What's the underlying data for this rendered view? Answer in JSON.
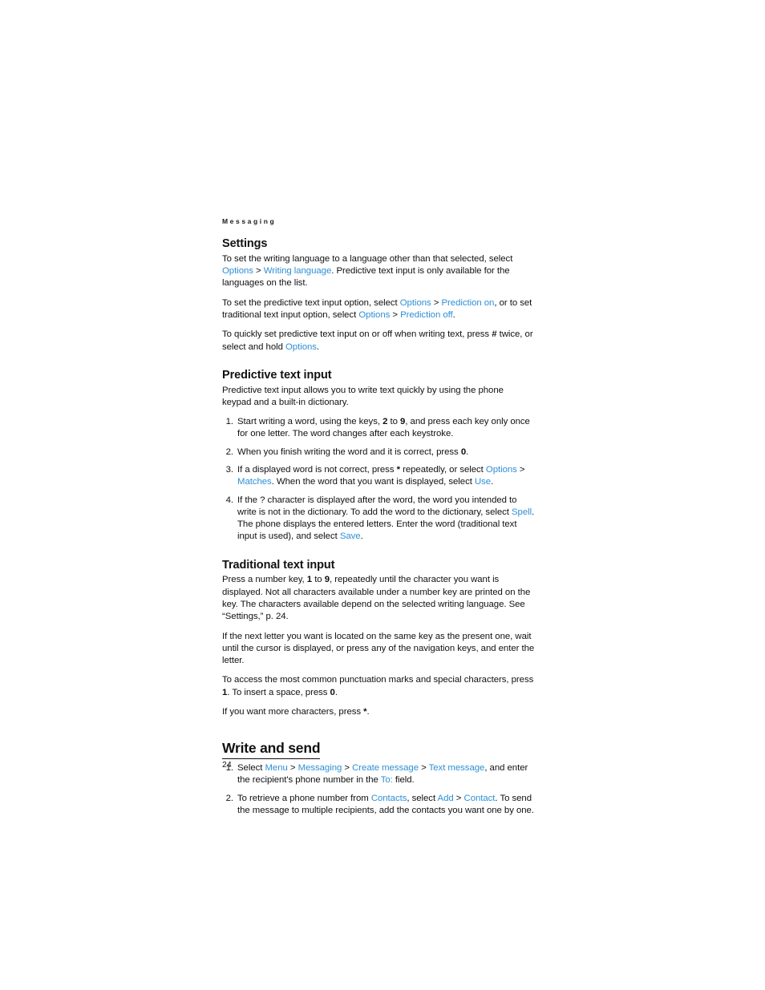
{
  "document": {
    "running_head": "Messaging",
    "page_number": "24",
    "link_color": "#2d8fd5",
    "text_color": "#111111"
  },
  "sections": {
    "settings": {
      "heading": "Settings",
      "p1": {
        "t1": "To set the writing language to a language other than that selected, select ",
        "l1": "Options",
        "t2": " > ",
        "l2": "Writing language",
        "t3": ". Predictive text input is only available for the languages on the list."
      },
      "p2": {
        "t1": "To set the predictive text input option, select ",
        "l1": "Options",
        "t2": " > ",
        "l2": "Prediction on",
        "t3": ", or to set traditional text input option, select ",
        "l3": "Options",
        "t4": " > ",
        "l4": "Prediction off",
        "t5": "."
      },
      "p3": {
        "t1": "To quickly set predictive text input on or off when writing text, press ",
        "k1": "#",
        "t2": " twice, or select and hold ",
        "l1": "Options",
        "t3": "."
      }
    },
    "predictive": {
      "heading": "Predictive text input",
      "intro": "Predictive text input allows you to write text quickly by using the phone keypad and a built-in dictionary.",
      "steps": [
        {
          "num": "1.",
          "t1": "Start writing a word, using the keys, ",
          "k1": "2",
          "t2": " to ",
          "k2": "9",
          "t3": ", and press each key only once for one letter. The word changes after each keystroke."
        },
        {
          "num": "2.",
          "t1": "When you finish writing the word and it is correct, press ",
          "k1": "0",
          "t2": "."
        },
        {
          "num": "3.",
          "t1": "If a displayed word is not correct, press ",
          "k1": "*",
          "t2": " repeatedly, or select ",
          "l1": "Options",
          "t3": " > ",
          "l2": "Matches",
          "t4": ". When the word that you want is displayed, select ",
          "l3": "Use",
          "t5": "."
        },
        {
          "num": "4.",
          "t1": "If the ? character is displayed after the word, the word you intended to write is not in the dictionary. To add the word to the dictionary, select ",
          "l1": "Spell",
          "t2": ". The phone displays the entered letters. Enter the word (traditional text input is used), and select ",
          "l2": "Save",
          "t3": "."
        }
      ]
    },
    "traditional": {
      "heading": "Traditional text input",
      "p1": {
        "t1": "Press a number key, ",
        "k1": "1",
        "t2": " to ",
        "k2": "9",
        "t3": ", repeatedly until the character you want is displayed. Not all characters available under a number key are printed on the key. The characters available depend on the selected writing language. See “Settings,” p. 24."
      },
      "p2": "If the next letter you want is located on the same key as the present one, wait until the cursor is displayed, or press any of the navigation keys, and enter the letter.",
      "p3": {
        "t1": "To access the most common punctuation marks and special characters, press ",
        "k1": "1",
        "t2": ". To insert a space, press ",
        "k2": "0",
        "t3": "."
      },
      "p4": {
        "t1": "If you want more characters, press ",
        "k1": "*",
        "t2": "."
      }
    },
    "write_and_send": {
      "heading": "Write and send",
      "steps": [
        {
          "num": "1.",
          "t1": "Select ",
          "l1": "Menu",
          "t2": " > ",
          "l2": "Messaging",
          "t3": " > ",
          "l3": "Create message",
          "t4": " > ",
          "l4": "Text message",
          "t5": ", and enter the recipient's phone number in the ",
          "l5": "To:",
          "t6": " field."
        },
        {
          "num": "2.",
          "t1": "To retrieve a phone number from ",
          "l1": "Contacts",
          "t2": ", select ",
          "l2": "Add",
          "t3": " > ",
          "l3": "Contact",
          "t4": ". To send the message to multiple recipients, add the contacts you want one by one."
        }
      ]
    }
  }
}
